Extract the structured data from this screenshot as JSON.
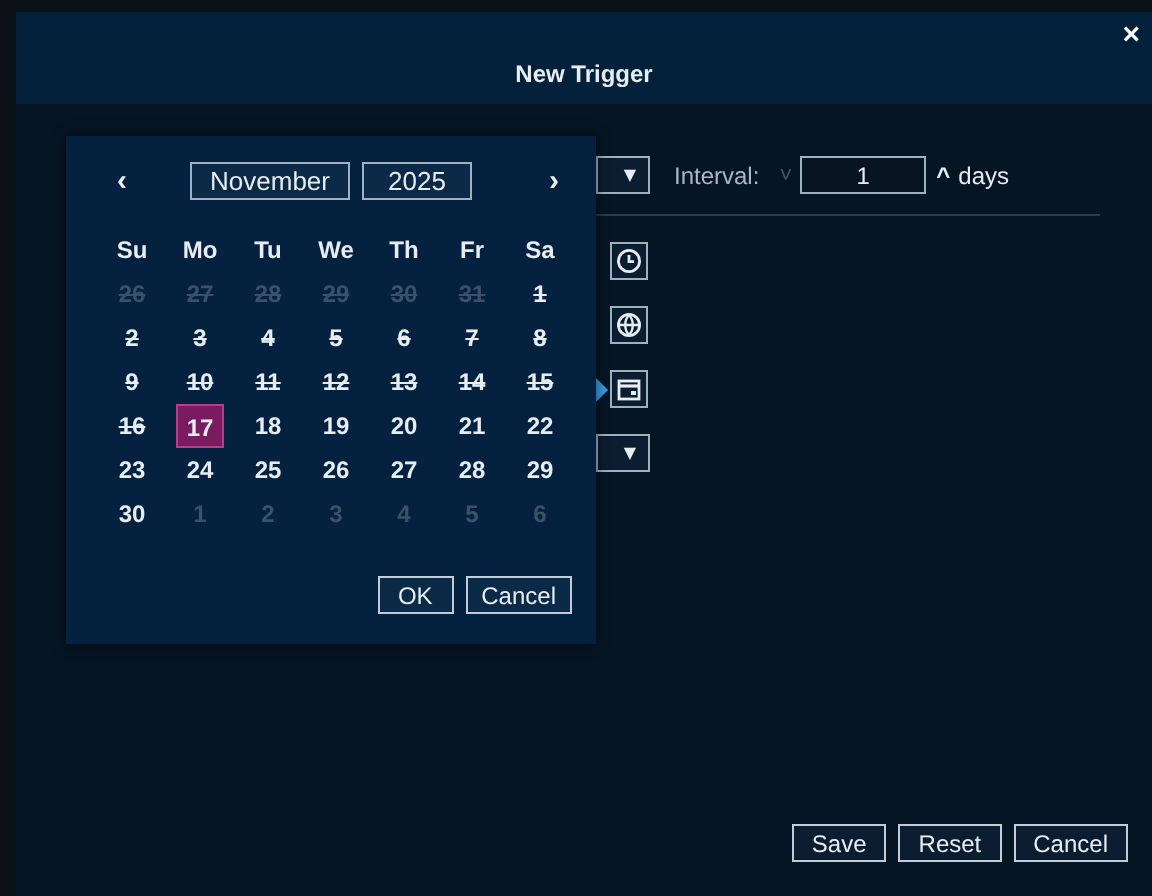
{
  "dialog": {
    "title": "New Trigger",
    "close": "×"
  },
  "form": {
    "interval_label": "Interval:",
    "interval_down": "˅",
    "interval_value": "1",
    "interval_up": "^",
    "interval_unit": "days",
    "select_caret": "▼",
    "second_select_caret": "▼",
    "icon_buttons": [
      {
        "kind": "clock",
        "selected": false
      },
      {
        "kind": "globe",
        "selected": false
      },
      {
        "kind": "calendar",
        "selected": true
      }
    ]
  },
  "date_picker": {
    "prev": "‹",
    "next": "›",
    "month": "November",
    "year": "2025",
    "weekdays": [
      "Su",
      "Mo",
      "Tu",
      "We",
      "Th",
      "Fr",
      "Sa"
    ],
    "days": [
      {
        "text": "26",
        "outside": true,
        "disabled": true,
        "selected": false
      },
      {
        "text": "27",
        "outside": true,
        "disabled": true,
        "selected": false
      },
      {
        "text": "28",
        "outside": true,
        "disabled": true,
        "selected": false
      },
      {
        "text": "29",
        "outside": true,
        "disabled": true,
        "selected": false
      },
      {
        "text": "30",
        "outside": true,
        "disabled": true,
        "selected": false
      },
      {
        "text": "31",
        "outside": true,
        "disabled": true,
        "selected": false
      },
      {
        "text": "1",
        "outside": false,
        "disabled": true,
        "selected": false
      },
      {
        "text": "2",
        "outside": false,
        "disabled": true,
        "selected": false
      },
      {
        "text": "3",
        "outside": false,
        "disabled": true,
        "selected": false
      },
      {
        "text": "4",
        "outside": false,
        "disabled": true,
        "selected": false
      },
      {
        "text": "5",
        "outside": false,
        "disabled": true,
        "selected": false
      },
      {
        "text": "6",
        "outside": false,
        "disabled": true,
        "selected": false
      },
      {
        "text": "7",
        "outside": false,
        "disabled": true,
        "selected": false
      },
      {
        "text": "8",
        "outside": false,
        "disabled": true,
        "selected": false
      },
      {
        "text": "9",
        "outside": false,
        "disabled": true,
        "selected": false
      },
      {
        "text": "10",
        "outside": false,
        "disabled": true,
        "selected": false
      },
      {
        "text": "11",
        "outside": false,
        "disabled": true,
        "selected": false
      },
      {
        "text": "12",
        "outside": false,
        "disabled": true,
        "selected": false
      },
      {
        "text": "13",
        "outside": false,
        "disabled": true,
        "selected": false
      },
      {
        "text": "14",
        "outside": false,
        "disabled": true,
        "selected": false
      },
      {
        "text": "15",
        "outside": false,
        "disabled": true,
        "selected": false
      },
      {
        "text": "16",
        "outside": false,
        "disabled": true,
        "selected": false
      },
      {
        "text": "17",
        "outside": false,
        "disabled": false,
        "selected": true
      },
      {
        "text": "18",
        "outside": false,
        "disabled": false,
        "selected": false
      },
      {
        "text": "19",
        "outside": false,
        "disabled": false,
        "selected": false
      },
      {
        "text": "20",
        "outside": false,
        "disabled": false,
        "selected": false
      },
      {
        "text": "21",
        "outside": false,
        "disabled": false,
        "selected": false
      },
      {
        "text": "22",
        "outside": false,
        "disabled": false,
        "selected": false
      },
      {
        "text": "23",
        "outside": false,
        "disabled": false,
        "selected": false
      },
      {
        "text": "24",
        "outside": false,
        "disabled": false,
        "selected": false
      },
      {
        "text": "25",
        "outside": false,
        "disabled": false,
        "selected": false
      },
      {
        "text": "26",
        "outside": false,
        "disabled": false,
        "selected": false
      },
      {
        "text": "27",
        "outside": false,
        "disabled": false,
        "selected": false
      },
      {
        "text": "28",
        "outside": false,
        "disabled": false,
        "selected": false
      },
      {
        "text": "29",
        "outside": false,
        "disabled": false,
        "selected": false
      },
      {
        "text": "30",
        "outside": false,
        "disabled": false,
        "selected": false
      },
      {
        "text": "1",
        "outside": true,
        "disabled": false,
        "selected": false
      },
      {
        "text": "2",
        "outside": true,
        "disabled": false,
        "selected": false
      },
      {
        "text": "3",
        "outside": true,
        "disabled": false,
        "selected": false
      },
      {
        "text": "4",
        "outside": true,
        "disabled": false,
        "selected": false
      },
      {
        "text": "5",
        "outside": true,
        "disabled": false,
        "selected": false
      },
      {
        "text": "6",
        "outside": true,
        "disabled": false,
        "selected": false
      }
    ],
    "buttons": [
      "OK",
      "Cancel"
    ]
  },
  "footer_buttons": [
    "Save",
    "Reset",
    "Cancel"
  ]
}
